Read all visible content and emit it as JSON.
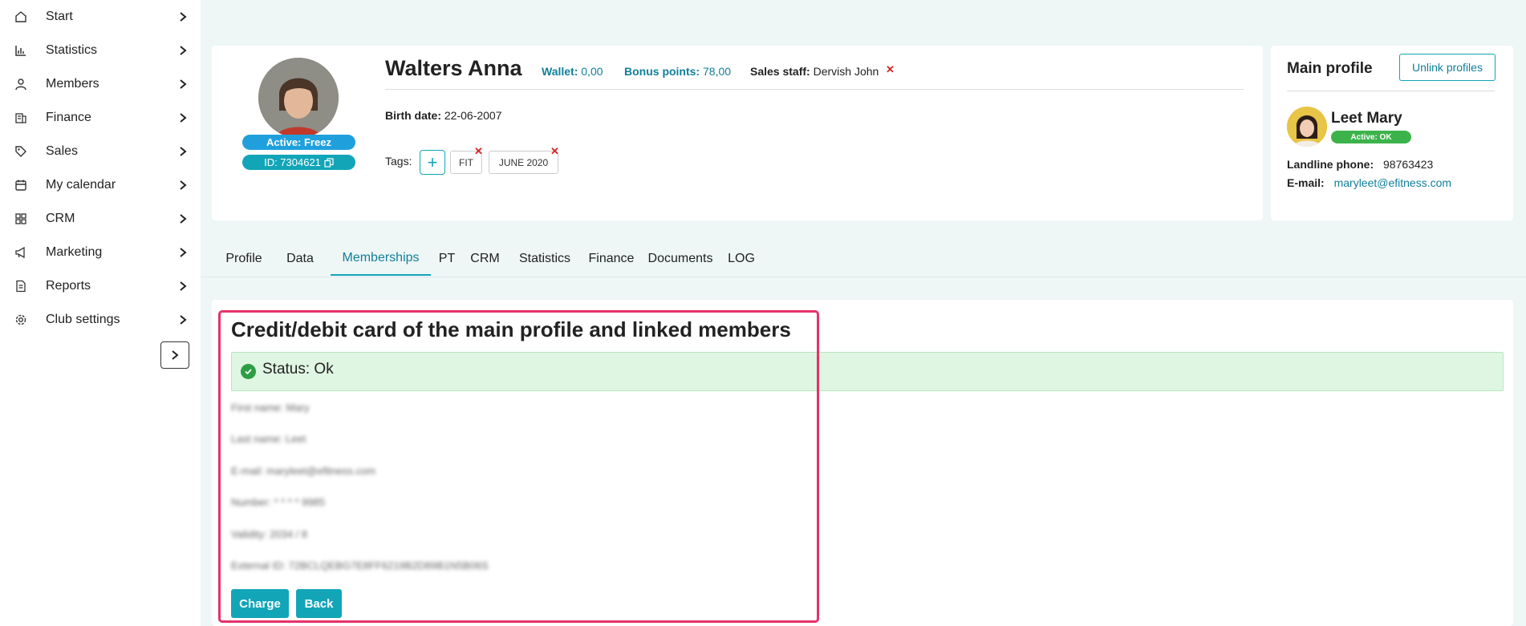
{
  "sidebar": {
    "items": [
      {
        "label": "Start",
        "icon": "home-icon"
      },
      {
        "label": "Statistics",
        "icon": "bar-chart-icon"
      },
      {
        "label": "Members",
        "icon": "user-icon"
      },
      {
        "label": "Finance",
        "icon": "money-icon"
      },
      {
        "label": "Sales",
        "icon": "tag-icon"
      },
      {
        "label": "My calendar",
        "icon": "calendar-icon"
      },
      {
        "label": "CRM",
        "icon": "grid-icon"
      },
      {
        "label": "Marketing",
        "icon": "megaphone-icon"
      },
      {
        "label": "Reports",
        "icon": "document-icon"
      },
      {
        "label": "Club settings",
        "icon": "gear-icon"
      }
    ]
  },
  "member": {
    "name": "Walters Anna",
    "status_badge": "Active: Freez",
    "id_badge": "ID: 7304621",
    "wallet_label": "Wallet:",
    "wallet_value": "0,00",
    "bonus_label": "Bonus points:",
    "bonus_value": "78,00",
    "sales_label": "Sales staff:",
    "sales_value": "Dervish John",
    "birth_label": "Birth date:",
    "birth_value": "22-06-2007",
    "tags_label": "Tags:",
    "tags": [
      "FIT",
      "JUNE 2020"
    ]
  },
  "main_profile": {
    "title": "Main profile",
    "unlink_label": "Unlink profiles",
    "name": "Leet Mary",
    "status_badge": "Active: OK",
    "phone_label": "Landline phone:",
    "phone_value": "98763423",
    "email_label": "E-mail:",
    "email_value": "maryleet@efitness.com"
  },
  "tabs": [
    "Profile",
    "Data",
    "Memberships",
    "PT",
    "CRM",
    "Statistics",
    "Finance",
    "Documents",
    "LOG"
  ],
  "active_tab": "Memberships",
  "card_section": {
    "title": "Credit/debit card of the main profile and linked members",
    "status": "Status: Ok",
    "blurred_lines": [
      "First name: Mary",
      "Last name: Leet",
      "E-mail: maryleet@efitness.com",
      "Number: * * * * 9985",
      "Validity: 2034 / 8",
      "External ID: 72BCLQEBG7E8FF6219B2D89B1N5B06S"
    ],
    "charge_label": "Charge",
    "back_label": "Back"
  },
  "colors": {
    "accent": "#12a5b8",
    "link": "#117f99",
    "status_blue": "#1fa0dd",
    "ok_green": "#3cb34a",
    "highlight": "#e5326a",
    "remove_red": "#d42424"
  }
}
